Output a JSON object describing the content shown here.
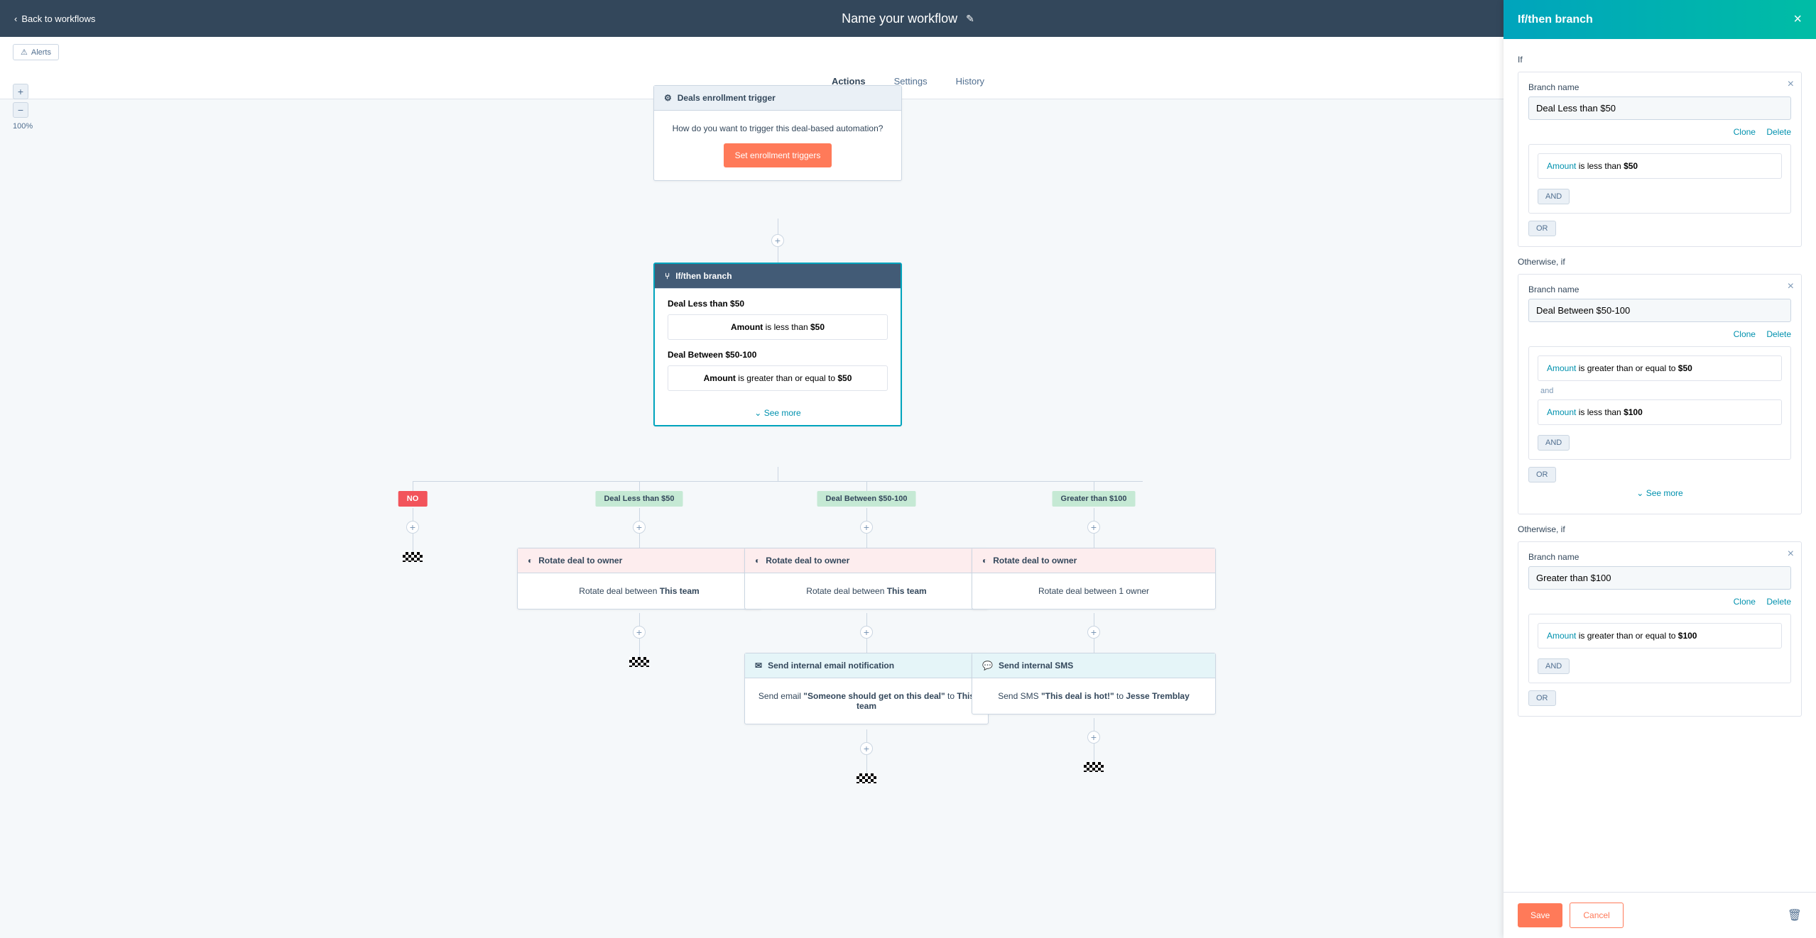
{
  "nav": {
    "back": "Back to workflows",
    "title": "Name your workflow"
  },
  "tabs": {
    "actions": "Actions",
    "settings": "Settings",
    "history": "History"
  },
  "alerts": "Alerts",
  "zoom": {
    "pct": "100%"
  },
  "trigger": {
    "title": "Deals enrollment trigger",
    "desc": "How do you want to trigger this deal-based automation?",
    "button": "Set enrollment triggers"
  },
  "ifthen": {
    "title": "If/then branch",
    "b1": {
      "name": "Deal Less than $50",
      "prop": "Amount",
      "op": " is less than ",
      "val": "$50"
    },
    "b2": {
      "name": "Deal Between $50-100",
      "prop": "Amount",
      "op": " is greater than or equal to ",
      "val": "$50"
    },
    "seemore": "See more"
  },
  "branches": {
    "no": "NO",
    "b1": "Deal Less than $50",
    "b2": "Deal Between $50-100",
    "b3": "Greater than $100"
  },
  "rotate": {
    "title": "Rotate deal to owner",
    "body_prefix": "Rotate deal between ",
    "team": "This team",
    "owner": "Rotate deal between 1 owner"
  },
  "email": {
    "title": "Send internal email notification",
    "p1": "Send email ",
    "subject": "\"Someone should get on this deal\"",
    "p2": " to ",
    "team": "This team"
  },
  "sms": {
    "title": "Send internal SMS",
    "p1": "Send SMS ",
    "subject": "\"This deal is hot!\"",
    "p2": " to ",
    "person": "Jesse Tremblay"
  },
  "panel": {
    "title": "If/then branch",
    "if": "If",
    "otherwise": "Otherwise, if",
    "branch_name": "Branch name",
    "clone": "Clone",
    "delete": "Delete",
    "and": "AND",
    "or": "OR",
    "and_text": "and",
    "seemore": "See more",
    "save": "Save",
    "cancel": "Cancel",
    "f1": {
      "name": "Deal Less than $50",
      "prop": "Amount",
      "op": " is less than ",
      "val": "$50"
    },
    "f2": {
      "name": "Deal Between $50-100",
      "c1": {
        "prop": "Amount",
        "op": " is greater than or equal to ",
        "val": "$50"
      },
      "c2": {
        "prop": "Amount",
        "op": " is less than ",
        "val": "$100"
      }
    },
    "f3": {
      "name": "Greater than $100",
      "prop": "Amount",
      "op": " is greater than or equal to ",
      "val": "$100"
    }
  }
}
